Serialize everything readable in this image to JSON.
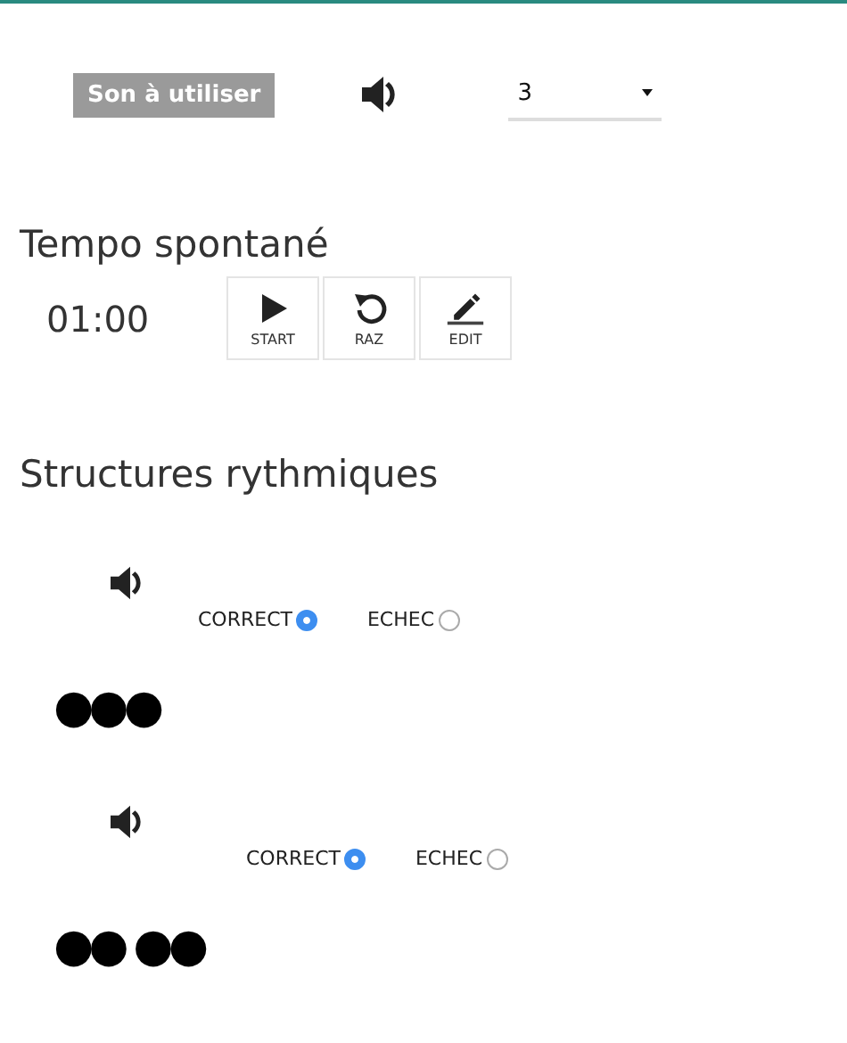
{
  "sound": {
    "label": "Son à utiliser",
    "select_value": "3"
  },
  "tempo": {
    "title": "Tempo spontané",
    "time": "01:00",
    "buttons": [
      {
        "kind": "start",
        "label": "START"
      },
      {
        "kind": "reset",
        "label": "RAZ"
      },
      {
        "kind": "edit",
        "label": "EDIT"
      }
    ]
  },
  "structures": {
    "title": "Structures rythmiques",
    "items": [
      {
        "options": [
          {
            "label": "CORRECT",
            "selected": true
          },
          {
            "label": "ECHEC",
            "selected": false
          }
        ],
        "rhythm": "●●●"
      },
      {
        "options": [
          {
            "label": "CORRECT",
            "selected": true
          },
          {
            "label": "ECHEC",
            "selected": false
          }
        ],
        "rhythm": "●● ●●"
      }
    ]
  }
}
